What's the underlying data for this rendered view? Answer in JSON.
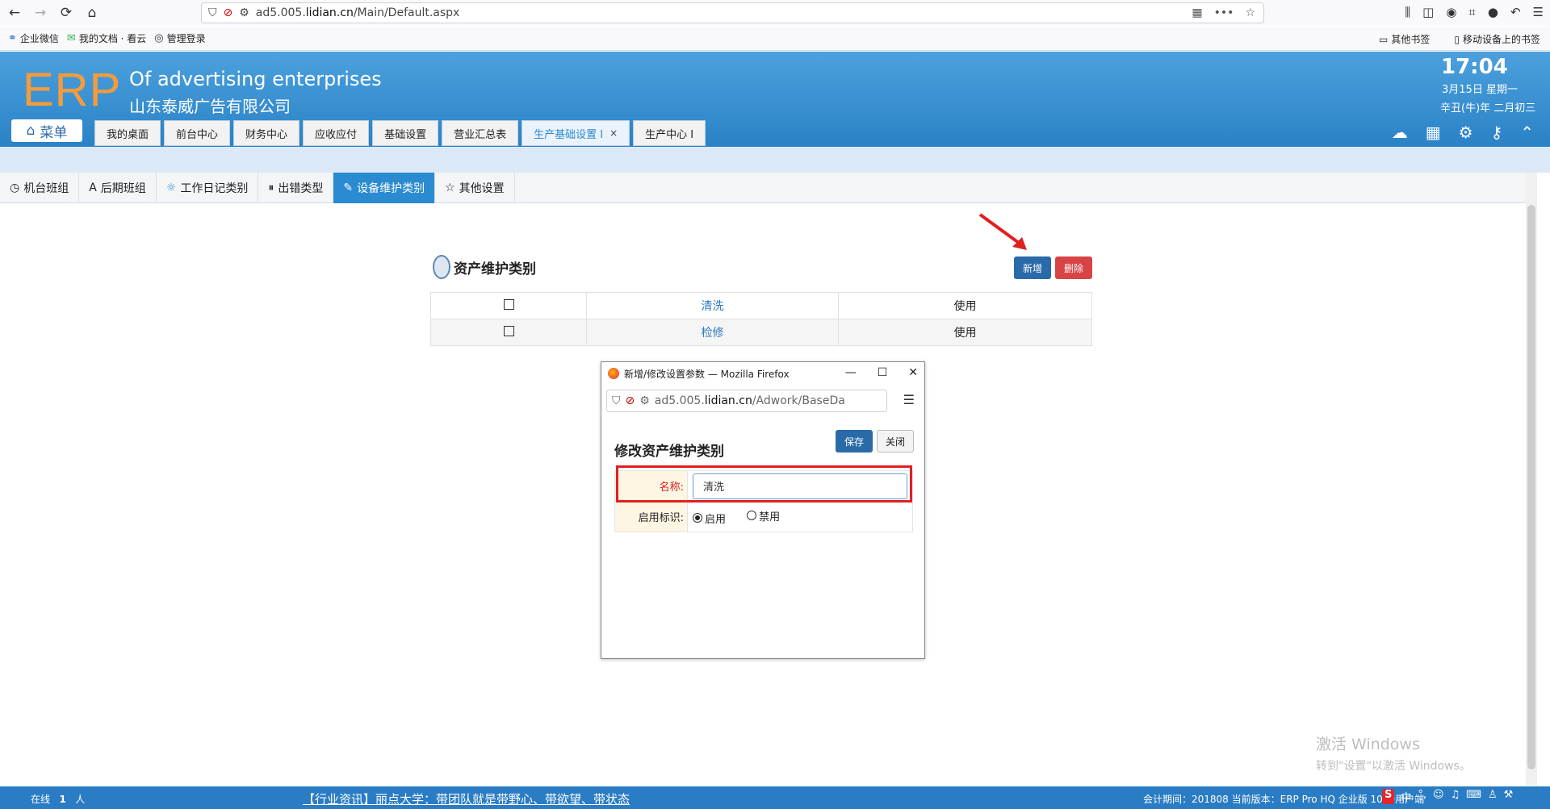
{
  "browser": {
    "url_prefix": "ad5.005.",
    "url_host": "lidian.cn",
    "url_path": "/Main/Default.aspx"
  },
  "bookmarks": {
    "items": [
      "企业微信",
      "我的文档 · 看云",
      "管理登录"
    ],
    "right": [
      "其他书签",
      "移动设备上的书签"
    ]
  },
  "header": {
    "logo": "ERP",
    "company_en": "Of advertising enterprises",
    "company_cn": "山东泰威广告有限公司",
    "time": "17:04",
    "date": "3月15日 星期一",
    "lunar": "辛丑(牛)年 二月初三",
    "menu_label": "菜单",
    "tabs": [
      "我的桌面",
      "前台中心",
      "财务中心",
      "应收应付",
      "基础设置",
      "营业汇总表",
      "生产基础设置 I",
      "生产中心 I"
    ],
    "active_tab_close": "×"
  },
  "subtabs": [
    "机台班组",
    "后期班组",
    "工作日记类别",
    "出错类型",
    "设备维护类别",
    "其他设置"
  ],
  "content": {
    "title": "资产维护类别",
    "add_label": "新增",
    "delete_label": "删除",
    "rows": [
      {
        "name": "清洗",
        "status": "使用"
      },
      {
        "name": "检修",
        "status": "使用"
      }
    ]
  },
  "popup": {
    "window_title": "新增/修改设置参数 — Mozilla Firefox",
    "url_prefix": "ad5.005.",
    "url_host": "lidian.cn",
    "url_path": "/Adwork/BaseDa",
    "save_label": "保存",
    "close_label": "关闭",
    "heading": "修改资产维护类别",
    "name_label": "名称:",
    "name_value": "清洗",
    "enable_label": "启用标识:",
    "radio_on": "启用",
    "radio_off": "禁用"
  },
  "watermark": {
    "line1": "激活 Windows",
    "line2": "转到\"设置\"以激活 Windows。"
  },
  "footer": {
    "online_label": "在线",
    "online_count": "1",
    "online_unit": "人",
    "news": "【行业资讯】丽点大学：带团队就是带野心、带欲望、带状态",
    "info": "会计期间：201808 当前版本：ERP Pro HQ 企业版 1000用户端",
    "ime": "中"
  },
  "colors": {
    "header_blue": "#2a82c6",
    "active_tab": "#2a8bd1",
    "logo_orange": "#f59b3b",
    "delete_red": "#d84346",
    "highlight_red": "#e02020"
  }
}
